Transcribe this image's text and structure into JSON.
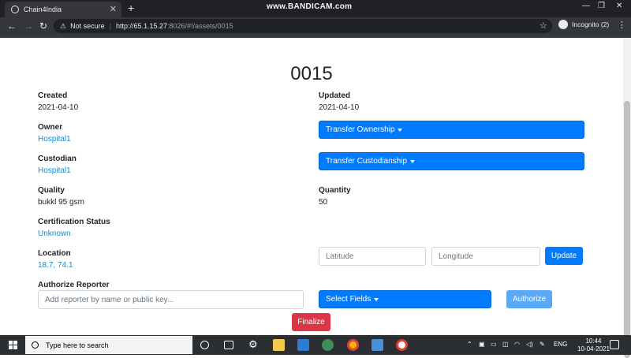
{
  "browser": {
    "tab_title": "Chain4India",
    "watermark": "www.BANDICAM.com",
    "security_label": "Not secure",
    "url_host": "http://65.1.15.27",
    "url_path": ":8026/#!/assets/0015",
    "profile_label": "Incognito (2)"
  },
  "asset": {
    "title": "0015",
    "created_label": "Created",
    "created_value": "2021-04-10",
    "updated_label": "Updated",
    "updated_value": "2021-04-10",
    "owner_label": "Owner",
    "owner_value": "Hospital1",
    "custodian_label": "Custodian",
    "custodian_value": "Hospital1",
    "quality_label": "Quality",
    "quality_value": "bukkl 95 gsm",
    "quantity_label": "Quantity",
    "quantity_value": "50",
    "certification_label": "Certification Status",
    "certification_value": "Unknown",
    "location_label": "Location",
    "location_value": "18.7, 74.1",
    "authorize_label": "Authorize Reporter"
  },
  "actions": {
    "transfer_ownership": "Transfer Ownership",
    "transfer_custodianship": "Transfer Custodianship",
    "latitude_placeholder": "Latitude",
    "longitude_placeholder": "Longitude",
    "update": "Update",
    "reporter_placeholder": "Add reporter by name or public key...",
    "select_fields": "Select Fields",
    "authorize": "Authorize",
    "finalize": "Finalize"
  },
  "colors": {
    "primary": "#007bff",
    "authorize_disabled": "#5aa9f7",
    "finalize": "#dc3545",
    "link": "#1c87c9"
  },
  "taskbar": {
    "search_placeholder": "Type here to search",
    "language": "ENG",
    "time": "10:44",
    "date": "10-04-2021"
  }
}
